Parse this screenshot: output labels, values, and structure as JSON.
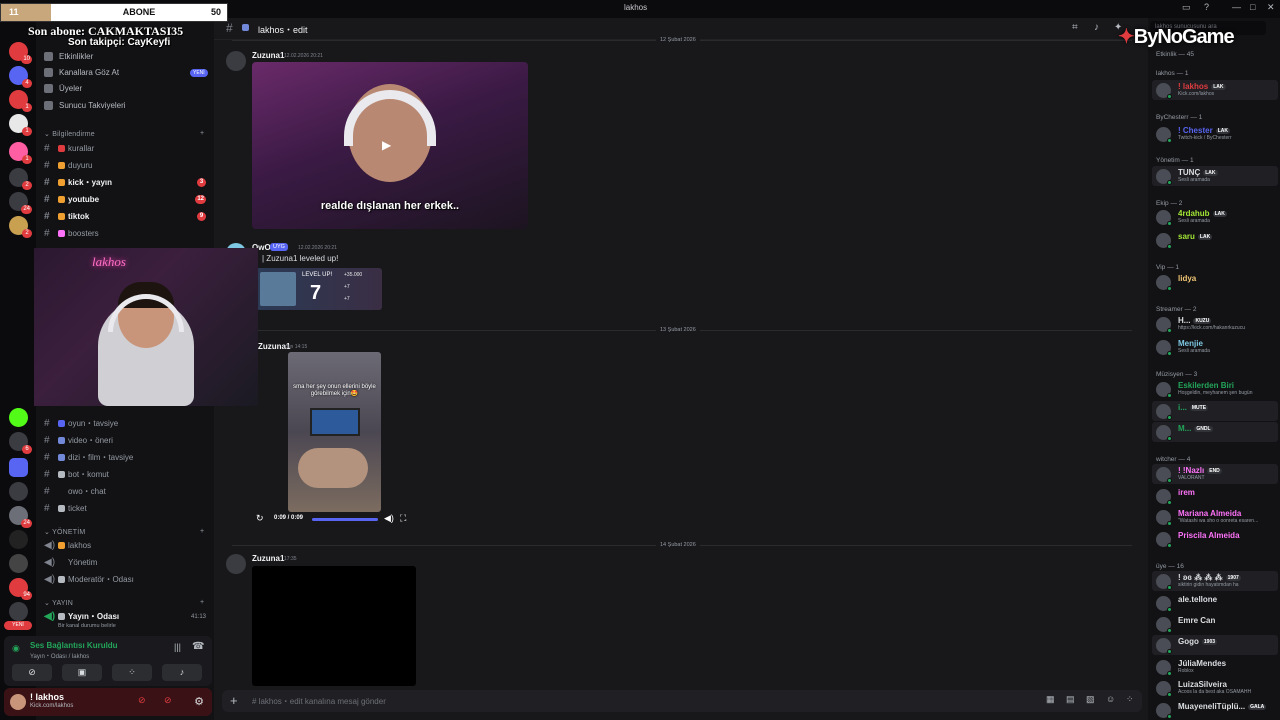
{
  "titlebar": {
    "title": "lakhos"
  },
  "overlay": {
    "abone_left": "11",
    "abone_label": "ABONE",
    "abone_right": "50",
    "son_abone": "Son abone: CAKMAKTASI35",
    "son_takipci": "Son takipçi: CayKeyfi",
    "brand": "ByNoGame",
    "cam_sign": "lakhos"
  },
  "sidebar": {
    "nav": [
      "Etkinlikler",
      "Kanallara Göz At",
      "Üyeler",
      "Sunucu Takviyeleri"
    ],
    "new_label": "YENİ",
    "cat_bilgi": "Bilgilendirme",
    "channels_top": [
      {
        "label": "kurallar",
        "bold": false,
        "count": ""
      },
      {
        "label": "duyuru",
        "bold": false,
        "count": ""
      },
      {
        "label": "kick・yayın",
        "bold": true,
        "count": "3"
      },
      {
        "label": "youtube",
        "bold": true,
        "count": "12"
      },
      {
        "label": "tiktok",
        "bold": true,
        "count": "9"
      },
      {
        "label": "boosters",
        "bold": false,
        "count": ""
      }
    ],
    "channels_mid": [
      "oyun・tavsiye",
      "video・öneri",
      "dizi・film・tavsiye",
      "bot・komut",
      "owo・chat",
      "ticket"
    ],
    "cat_yonetim": "YÖNETİM",
    "voice_yonetim": [
      "lakhos",
      "Yönetim",
      "Moderatör・Odası"
    ],
    "cat_yayin": "YAYIN",
    "voice_yayin": "Yayın・Odası",
    "voice_yayin_time": "41:13",
    "voice_yayin_status": "Bir kanal durumu belirle"
  },
  "voice": {
    "title": "Ses Bağlantısı Kuruldu",
    "sub": "Yayın・Odası / lakhos"
  },
  "user": {
    "name": "! lakhos",
    "status": "Kick.com/lakhos"
  },
  "chat": {
    "channel": "lakhos・edit",
    "date1": "12 Şubat 2026",
    "msg1": {
      "user": "Zuzuna1",
      "ts": "12.02.2026 20:21",
      "subtitle": "realde dışlanan her erkek.."
    },
    "msg2": {
      "user": "OwO",
      "tag": "UYG",
      "ts": "12.02.2026 20:21",
      "text": "| Zuzuna1 leveled up!",
      "level_label": "LEVEL UP!",
      "level": "7",
      "reward1": "+35.000",
      "reward2": "+7",
      "reward3": "+7"
    },
    "date2": "13 Şubat 2026",
    "msg3": {
      "user": "Zuzuna1",
      "ts": "dün 14:15",
      "caption": "sma her şey onun ellerini böyle görebilmek için🤩",
      "time": "0:09 / 0:09"
    },
    "date3": "14 Şubat 2026",
    "msg4": {
      "user": "Zuzuna1",
      "ts": "17:35"
    },
    "composer": "# lakhos・edit kanalına mesaj gönder"
  },
  "members": {
    "search": "lakhos sunucusunu ara",
    "cat_etkinlik": "Etkinlik — 45",
    "groups": [
      {
        "title": "lakhos — 1",
        "members": [
          {
            "name": "! lakhos",
            "tag": "LAK",
            "sub": "Kick.com/lakhos",
            "color": "#e03c3f",
            "hl": true
          }
        ]
      },
      {
        "title": "ByChesterr — 1",
        "members": [
          {
            "name": "! Chester",
            "tag": "LAK",
            "sub": "Twitch-kick / ByChesterr",
            "color": "#5865f2",
            "hl": false
          }
        ]
      },
      {
        "title": "Yönetim — 1",
        "members": [
          {
            "name": "TUNÇ",
            "tag": "LAK",
            "sub": "Sesli aramada",
            "color": "#dbdee1",
            "hl": true
          }
        ]
      },
      {
        "title": "Ekip — 2",
        "members": [
          {
            "name": "4rdahub",
            "tag": "LAK",
            "sub": "Sesli aramada",
            "color": "#a3e635",
            "hl": false
          },
          {
            "name": "saru",
            "tag": "LAK",
            "sub": "",
            "color": "#a3e635",
            "hl": false
          }
        ]
      },
      {
        "title": "Vip — 1",
        "members": [
          {
            "name": "lidya",
            "tag": "",
            "sub": "",
            "color": "#f0c674",
            "hl": false
          }
        ]
      },
      {
        "title": "Streamer — 2",
        "members": [
          {
            "name": "H...",
            "tag": "KUZU",
            "sub": "https://kick.com/hakanrkuzucu",
            "color": "#dbdee1",
            "hl": false
          },
          {
            "name": "Menjie",
            "tag": "",
            "sub": "Sesli aramada",
            "color": "#7ec8e3",
            "hl": false
          }
        ]
      },
      {
        "title": "Müzisyen — 3",
        "members": [
          {
            "name": "Eskilerden Biri",
            "tag": "",
            "sub": "Hoşgeldin, meyhanem şen bugün",
            "color": "#23a55a",
            "hl": false
          },
          {
            "name": "i...",
            "tag": "MUTE",
            "sub": "",
            "color": "#23a55a",
            "hl": true
          },
          {
            "name": "M...",
            "tag": "GNDL",
            "sub": "",
            "color": "#23a55a",
            "hl": true
          }
        ]
      },
      {
        "title": "witcher — 4",
        "members": [
          {
            "name": "! !Nazlı",
            "tag": "END",
            "sub": "VALORANT",
            "color": "#ff73fa",
            "hl": true
          },
          {
            "name": "irem",
            "tag": "",
            "sub": "",
            "color": "#ff73fa",
            "hl": false
          },
          {
            "name": "Mariana Almeida",
            "tag": "",
            "sub": "\"Watashi wa sho o oonreta esaren...",
            "color": "#ff73fa",
            "hl": false
          },
          {
            "name": "Priscila Almeida",
            "tag": "",
            "sub": "",
            "color": "#ff73fa",
            "hl": false
          }
        ]
      },
      {
        "title": "üye — 16",
        "members": [
          {
            "name": "! ʚɞ ⁂ ⁂ ⁂",
            "tag": "1907",
            "sub": "siktirin gidin hayatımdan ha",
            "color": "#dbdee1",
            "hl": true
          },
          {
            "name": "ale.tellone",
            "tag": "",
            "sub": "",
            "color": "#dbdee1",
            "hl": false
          },
          {
            "name": "Emre Can",
            "tag": "",
            "sub": "",
            "color": "#dbdee1",
            "hl": false
          },
          {
            "name": "Gogo",
            "tag": "1903",
            "sub": "",
            "color": "#dbdee1",
            "hl": true
          },
          {
            "name": "JúliaMendes",
            "tag": "",
            "sub": "Roblox",
            "color": "#dbdee1",
            "hl": false
          },
          {
            "name": "LuizaSilveira",
            "tag": "",
            "sub": "Acoos la da best aka OSAMAHH",
            "color": "#dbdee1",
            "hl": false
          },
          {
            "name": "MuayeneliTüplü...",
            "tag": "GALA",
            "sub": "",
            "color": "#dbdee1",
            "hl": false
          }
        ]
      }
    ]
  },
  "colors": {
    "accent": "#5865f2",
    "online": "#23a55a",
    "danger": "#e03c3f"
  }
}
